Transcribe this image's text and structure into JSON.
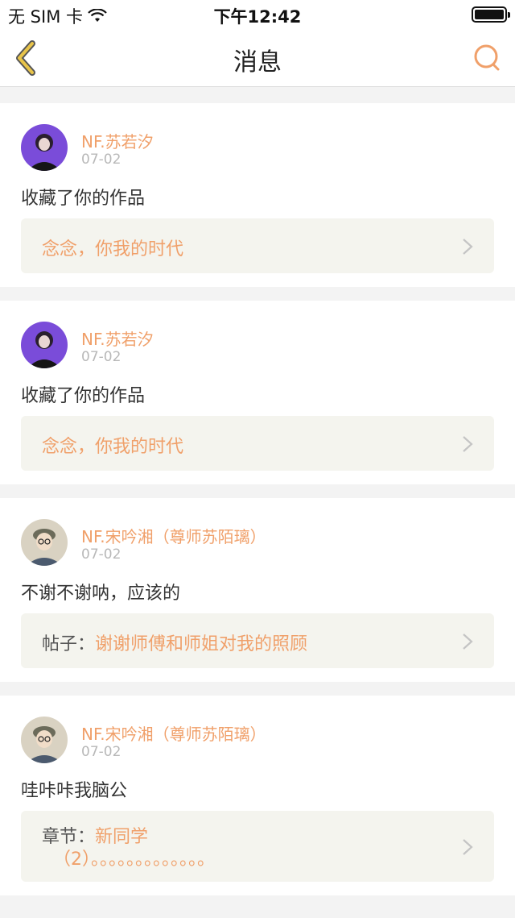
{
  "status": {
    "carrier": "无 SIM 卡",
    "time": "下午12:42"
  },
  "nav": {
    "title": "消息",
    "back_icon": "back-chevron-icon",
    "search_icon": "search-icon"
  },
  "colors": {
    "accent": "#f0a06a",
    "back_icon": "#e8c44a",
    "ref_background": "#f4f4ee"
  },
  "messages": [
    {
      "username": "NF.苏若汐",
      "date": "07-02",
      "text": "收藏了你的作品",
      "ref_prefix": "",
      "ref_title": "念念，你我的时代",
      "ref_line2": ""
    },
    {
      "username": "NF.苏若汐",
      "date": "07-02",
      "text": "收藏了你的作品",
      "ref_prefix": "",
      "ref_title": "念念，你我的时代",
      "ref_line2": ""
    },
    {
      "username": "NF.宋吟湘（尊师苏陌璃）",
      "date": "07-02",
      "text": "不谢不谢呐，应该的",
      "ref_prefix": "帖子：",
      "ref_title": "谢谢师傅和师姐对我的照顾",
      "ref_line2": ""
    },
    {
      "username": "NF.宋吟湘（尊师苏陌璃）",
      "date": "07-02",
      "text": "哇咔咔我脑公",
      "ref_prefix": "章节：",
      "ref_title": "新同学",
      "ref_line2": "（2）。。。。。。。。。。。。。"
    }
  ]
}
